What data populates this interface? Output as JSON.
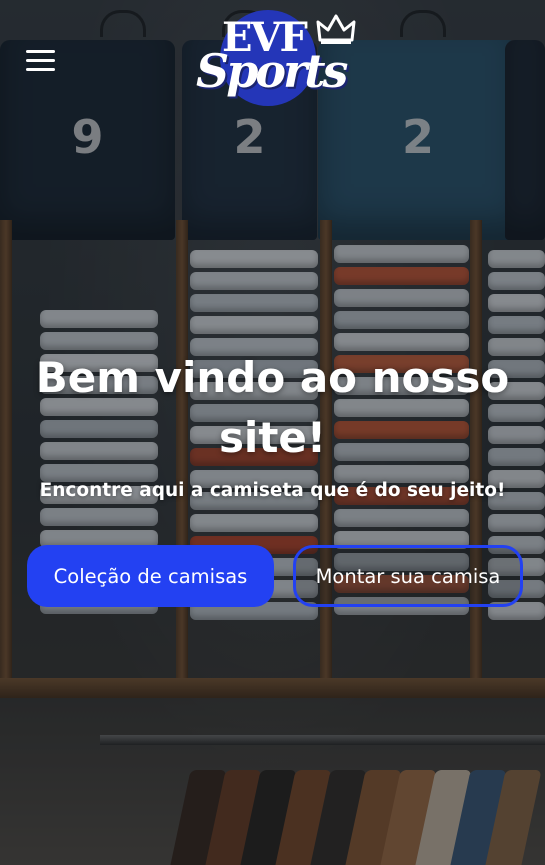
{
  "header": {
    "menu_icon": "hamburger-menu-icon",
    "logo": {
      "line1": "EVF",
      "line2": "Sports",
      "crown_icon": "crown-icon",
      "circle_color": "#2436b8"
    }
  },
  "hero": {
    "title": "Bem vindo ao nosso site!",
    "subtitle": "Encontre aqui a camiseta que é do seu jeito!",
    "primary_button": "Coleção de camisas",
    "secondary_button": "Montar sua camisa"
  },
  "background": {
    "jersey_numbers": [
      "9",
      "2",
      "2"
    ]
  },
  "colors": {
    "accent": "#2341f2",
    "text": "#ffffff"
  }
}
